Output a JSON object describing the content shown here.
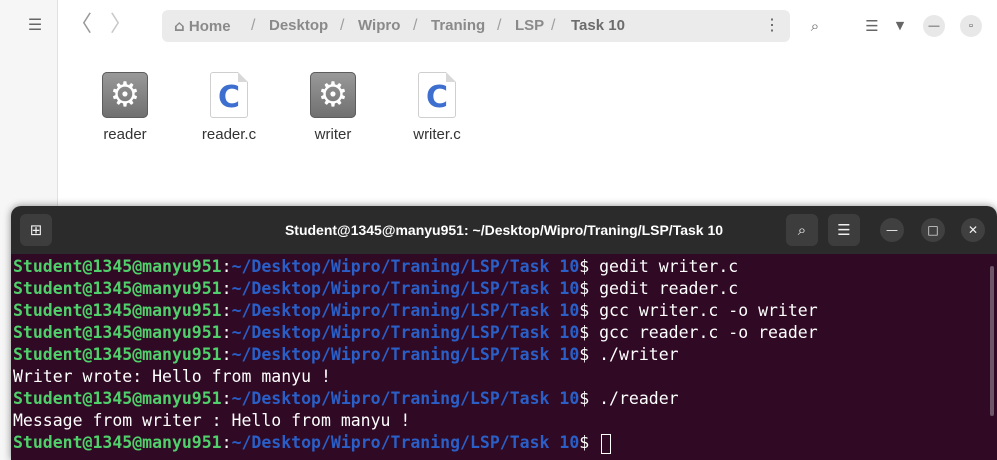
{
  "file_manager": {
    "breadcrumb": [
      "Home",
      "Desktop",
      "Wipro",
      "Traning",
      "LSP",
      "Task 10"
    ],
    "files": [
      {
        "name": "reader",
        "type": "executable",
        "icon": "gear-icon"
      },
      {
        "name": "reader.c",
        "type": "c-source",
        "icon": "c-file-icon",
        "glyph": "C"
      },
      {
        "name": "writer",
        "type": "executable",
        "icon": "gear-icon"
      },
      {
        "name": "writer.c",
        "type": "c-source",
        "icon": "c-file-icon",
        "glyph": "C"
      }
    ]
  },
  "terminal": {
    "title": "Student@1345@manyu951: ~/Desktop/Wipro/Traning/LSP/Task 10",
    "prompt_user": "Student@1345@manyu951",
    "prompt_path": "~/Desktop/Wipro/Traning/LSP/Task 10",
    "lines": [
      {
        "kind": "prompt",
        "cmd": " gedit writer.c"
      },
      {
        "kind": "prompt",
        "cmd": " gedit reader.c"
      },
      {
        "kind": "prompt",
        "cmd": " gcc writer.c -o writer"
      },
      {
        "kind": "prompt",
        "cmd": " gcc reader.c -o reader"
      },
      {
        "kind": "prompt",
        "cmd": " ./writer"
      },
      {
        "kind": "output",
        "text": "Writer wrote: Hello from manyu !"
      },
      {
        "kind": "prompt",
        "cmd": " ./reader"
      },
      {
        "kind": "output",
        "text": "Message from writer : Hello from manyu !"
      },
      {
        "kind": "prompt",
        "cmd": " ",
        "cursor": true
      }
    ],
    "colors": {
      "background": "#300a24",
      "user": "#4fd06a",
      "path": "#2a5fc8"
    }
  }
}
